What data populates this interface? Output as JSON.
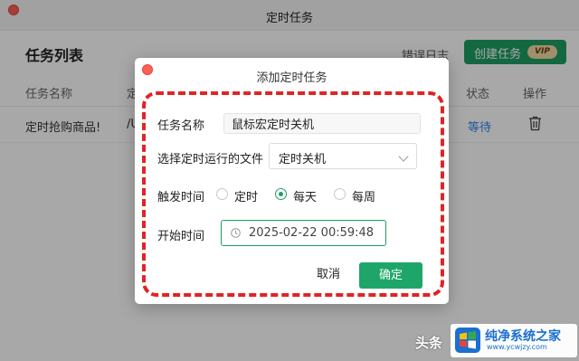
{
  "window": {
    "title": "定时任务",
    "header_title": "任务列表",
    "error_log_label": "错误日志",
    "create_button_label": "创建任务",
    "vip_badge": "VIP"
  },
  "table": {
    "columns": [
      "任务名称",
      "定",
      "状态",
      "操作"
    ],
    "rows": [
      {
        "name": "定时抢购商品!",
        "col2": "/U",
        "status": "等待",
        "action_icon": "trash-icon"
      }
    ]
  },
  "dialog": {
    "title": "添加定时任务",
    "task_name_label": "任务名称",
    "task_name_value": "鼠标宏定时关机",
    "file_label": "选择定时运行的文件",
    "file_value": "定时关机",
    "trigger_label": "触发时间",
    "trigger_options": [
      "定时",
      "每天",
      "每周"
    ],
    "trigger_selected": "每天",
    "start_label": "开始时间",
    "start_value": "2025-02-22 00:59:48",
    "cancel_label": "取消",
    "ok_label": "确定"
  },
  "watermark": {
    "left_text": "头条",
    "site_name": "纯净系统之家",
    "site_url": "www.ycwjzy.com"
  },
  "colors": {
    "accent": "#1e9e63",
    "annotation": "#e02424",
    "status_link": "#2f80ed"
  }
}
